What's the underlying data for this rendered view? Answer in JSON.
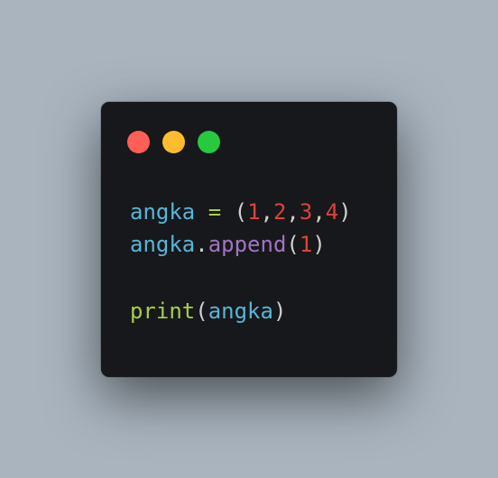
{
  "window": {
    "controls": [
      {
        "name": "close",
        "color": "#ff5f57"
      },
      {
        "name": "minimize",
        "color": "#febc2e"
      },
      {
        "name": "maximize",
        "color": "#28c840"
      }
    ]
  },
  "colors": {
    "background": "#a9b4bf",
    "window": "#17181b",
    "variable": "#56b6d8",
    "operator": "#a6cf4a",
    "punctuation": "#d0d0d0",
    "number": "#e0413a",
    "method": "#a074c4",
    "builtin": "#a6cf4a"
  },
  "code": {
    "lines": [
      [
        {
          "text": "angka",
          "role": "variable"
        },
        {
          "text": " ",
          "role": "punctuation"
        },
        {
          "text": "=",
          "role": "operator"
        },
        {
          "text": " ",
          "role": "punctuation"
        },
        {
          "text": "(",
          "role": "punctuation"
        },
        {
          "text": "1",
          "role": "number"
        },
        {
          "text": ",",
          "role": "punctuation"
        },
        {
          "text": "2",
          "role": "number"
        },
        {
          "text": ",",
          "role": "punctuation"
        },
        {
          "text": "3",
          "role": "number"
        },
        {
          "text": ",",
          "role": "punctuation"
        },
        {
          "text": "4",
          "role": "number"
        },
        {
          "text": ")",
          "role": "punctuation"
        }
      ],
      [
        {
          "text": "angka",
          "role": "variable"
        },
        {
          "text": ".",
          "role": "punctuation"
        },
        {
          "text": "append",
          "role": "method"
        },
        {
          "text": "(",
          "role": "punctuation"
        },
        {
          "text": "1",
          "role": "number"
        },
        {
          "text": ")",
          "role": "punctuation"
        }
      ],
      [],
      [
        {
          "text": "print",
          "role": "builtin"
        },
        {
          "text": "(",
          "role": "punctuation"
        },
        {
          "text": "angka",
          "role": "variable"
        },
        {
          "text": ")",
          "role": "punctuation"
        }
      ]
    ]
  }
}
